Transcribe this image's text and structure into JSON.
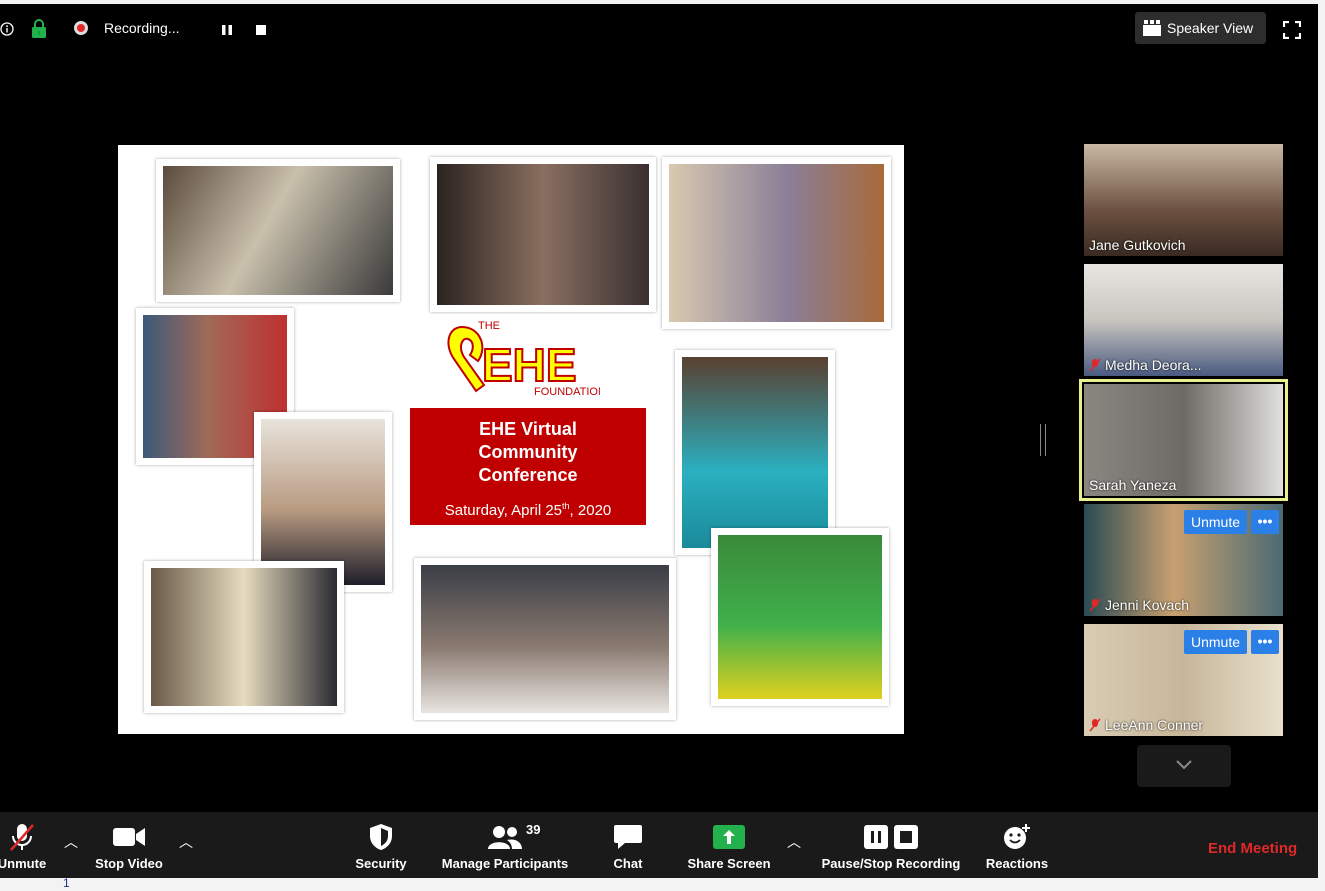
{
  "topbar": {
    "recording_label": "Recording...",
    "speaker_view_label": "Speaker View"
  },
  "slide": {
    "logo_the": "THE",
    "logo_main": "EHE",
    "logo_foundation": "FOUNDATION",
    "title": "EHE Virtual Community Conference",
    "date_prefix": "Saturday, April 25",
    "date_sup": "th",
    "date_suffix": ", 2020"
  },
  "participants": [
    {
      "name": "Jane Gutkovich",
      "muted": false,
      "bg": "#6b5040",
      "active": false
    },
    {
      "name": "Medha Deora...",
      "muted": true,
      "bg": "#c9c6c0",
      "active": false
    },
    {
      "name": "Sarah Yaneza",
      "muted": false,
      "bg": "#6e6a66",
      "active": true
    },
    {
      "name": "Jenni Kovach",
      "muted": true,
      "bg": "#4a6a74",
      "active": false,
      "unmute_label": "Unmute"
    },
    {
      "name": "LeeAnn Conner",
      "muted": true,
      "bg": "#c7b69a",
      "active": false,
      "unmute_label": "Unmute"
    }
  ],
  "toolbar": {
    "unmute_label": "Unmute",
    "stop_video_label": "Stop Video",
    "security_label": "Security",
    "participants_label": "Manage Participants",
    "participants_count": "39",
    "chat_label": "Chat",
    "share_screen_label": "Share Screen",
    "recording_label": "Pause/Stop Recording",
    "reactions_label": "Reactions",
    "end_meeting_label": "End Meeting"
  },
  "bottom_strip": {
    "line_number": "1"
  },
  "colors": {
    "accent_blue": "#2b80e8",
    "end_meeting_red": "#e02828",
    "share_green": "#23b14d",
    "active_speaker": "#e8f08c"
  }
}
